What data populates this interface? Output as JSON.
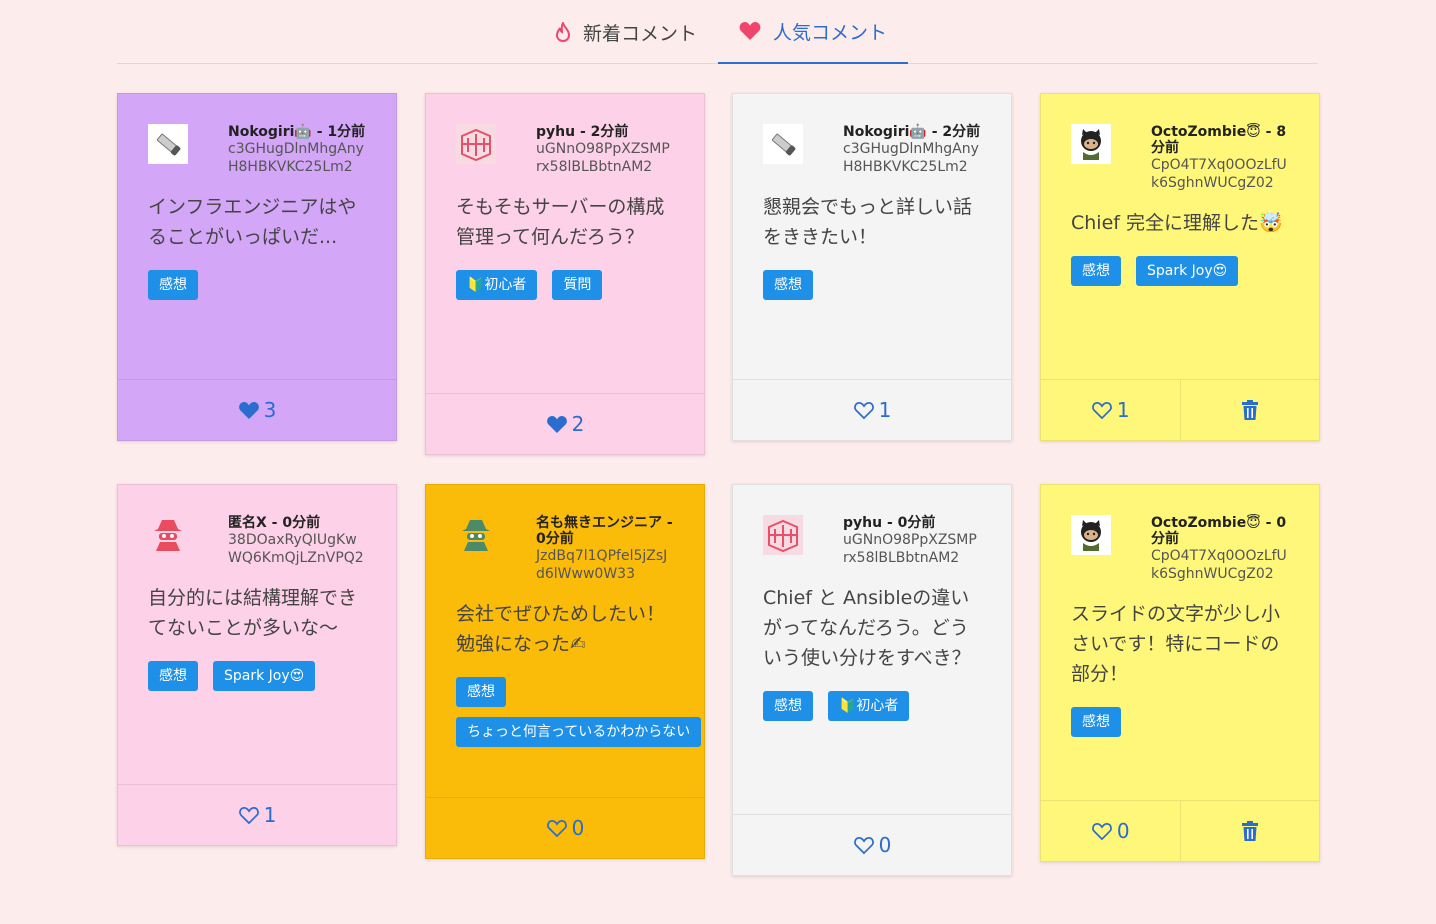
{
  "tabs": {
    "new_label": "新着コメント",
    "popular_label": "人気コメント"
  },
  "cards": [
    {
      "name": "Nokogiri🤖 - 1分前",
      "uid": "c3GHugDlnMhgAnyH8HBKVKC25Lm2",
      "comment": "インフラエンジニアはやることがいっぱいだ...",
      "tags": [
        "感想"
      ],
      "likes": "3",
      "liked": true,
      "color": "#d3a6f7",
      "avatar": "saw"
    },
    {
      "name": "pyhu - 2分前",
      "uid": "uGNnO98PpXZSMPrx58lBLBbtnAM2",
      "comment": "そもそもサーバーの構成管理って何んだろう？",
      "tags": [
        "🔰初心者",
        "質問"
      ],
      "likes": "2",
      "liked": true,
      "color": "#fdd1e8",
      "avatar": "pyhu"
    },
    {
      "name": "Nokogiri🤖 - 2分前",
      "uid": "c3GHugDlnMhgAnyH8HBKVKC25Lm2",
      "comment": "懇親会でもっと詳しい話をききたい！",
      "tags": [
        "感想"
      ],
      "likes": "1",
      "liked": false,
      "color": "#f4f4f4",
      "avatar": "saw"
    },
    {
      "name": "OctoZombie😇 - 8分前",
      "uid": "CpO4T7Xq0OOzLfUk6SghnWUCgZ02",
      "comment": "Chief 完全に理解した🤯",
      "tags": [
        "感想",
        "Spark Joy😍"
      ],
      "likes": "1",
      "liked": false,
      "color": "#fff77a",
      "avatar": "octo",
      "deletable": true
    },
    {
      "name": "匿名X - 0分前",
      "uid": "38DOaxRyQIUgKwWQ6KmQjLZnVPQ2",
      "comment": "自分的には結構理解できてないことが多いな〜",
      "tags": [
        "感想",
        "Spark Joy😍"
      ],
      "likes": "1",
      "liked": false,
      "color": "#fdd1e8",
      "avatar": "spy-pink"
    },
    {
      "name": "名も無きエンジニア - 0分前",
      "uid": "JzdBq7l1QPfel5jZsJd6lWww0W33",
      "comment": "会社でぜひためしたい！勉強になった✍",
      "tags": [
        "感想",
        "ちょっと何言っているかわからない"
      ],
      "likes": "0",
      "liked": false,
      "color": "#fbbb09",
      "avatar": "spy-green"
    },
    {
      "name": "pyhu - 0分前",
      "uid": "uGNnO98PpXZSMPrx58lBLBbtnAM2",
      "comment": "Chief と Ansibleの違いがってなんだろう。どういう使い分けをすべき？",
      "tags": [
        "感想",
        "🔰初心者"
      ],
      "likes": "0",
      "liked": false,
      "color": "#f4f4f4",
      "avatar": "pyhu"
    },
    {
      "name": "OctoZombie😇 - 0分前",
      "uid": "CpO4T7Xq0OOzLfUk6SghnWUCgZ02",
      "comment": "スライドの文字が少し小さいです！特にコードの部分！",
      "tags": [
        "感想"
      ],
      "likes": "0",
      "liked": false,
      "color": "#fff77a",
      "avatar": "octo",
      "deletable": true
    }
  ]
}
